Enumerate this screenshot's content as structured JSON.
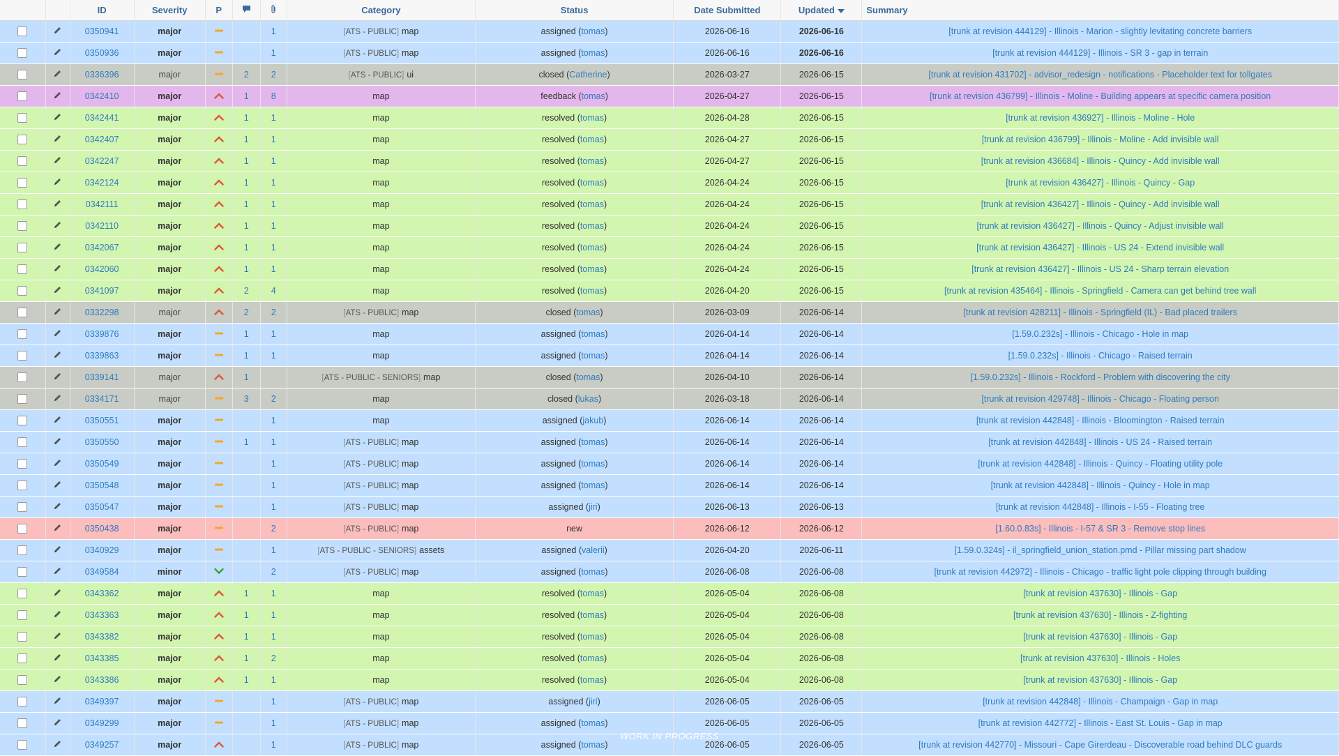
{
  "columns": {
    "id": "ID",
    "severity": "Severity",
    "priority": "P",
    "notes_icon": "speech-bubble-icon",
    "attachments_icon": "paperclip-icon",
    "category": "Category",
    "status": "Status",
    "date_submitted": "Date Submitted",
    "updated": "Updated",
    "summary": "Summary"
  },
  "colors": {
    "assigned": "#c2dfff",
    "resolved": "#d2f5b0",
    "closed": "#c9ccc4",
    "feedback": "#e3b7eb",
    "new": "#fcbdbd",
    "link": "#2f7bbf",
    "priority_high": "#e0563b",
    "priority_normal": "#f5a623",
    "priority_low": "#3aa23a"
  },
  "footer_overlay": "WORK IN PROGRESS",
  "rows": [
    {
      "id": "0350941",
      "severity": "major",
      "priority": "normal",
      "notes": "",
      "attachments": "1",
      "project": "ATS - PUBLIC",
      "category": "map",
      "status": "assigned",
      "handler": "tomas",
      "submitted": "2026-06-16",
      "updated": "2026-06-16",
      "updated_bold": true,
      "summary": "[trunk at revision 444129] - Illinois - Marion - slightly levitating concrete barriers"
    },
    {
      "id": "0350936",
      "severity": "major",
      "priority": "normal",
      "notes": "",
      "attachments": "1",
      "project": "ATS - PUBLIC",
      "category": "map",
      "status": "assigned",
      "handler": "tomas",
      "submitted": "2026-06-16",
      "updated": "2026-06-16",
      "updated_bold": true,
      "summary": "[trunk at revision 444129] - Illinois - SR 3 - gap in terrain"
    },
    {
      "id": "0336396",
      "severity": "major",
      "priority": "normal",
      "notes": "2",
      "attachments": "2",
      "project": "ATS - PUBLIC",
      "category": "ui",
      "status": "closed",
      "handler": "Catherine",
      "submitted": "2026-03-27",
      "updated": "2026-06-15",
      "updated_bold": false,
      "summary": "[trunk at revision 431702] - advisor_redesign - notifications - Placeholder text for tollgates"
    },
    {
      "id": "0342410",
      "severity": "major",
      "priority": "high",
      "notes": "1",
      "attachments": "8",
      "project": "",
      "category": "map",
      "status": "feedback",
      "handler": "tomas",
      "submitted": "2026-04-27",
      "updated": "2026-06-15",
      "updated_bold": false,
      "summary": "[trunk at revision 436799] - Illinois - Moline - Building appears at specific camera position"
    },
    {
      "id": "0342441",
      "severity": "major",
      "priority": "high",
      "notes": "1",
      "attachments": "1",
      "project": "",
      "category": "map",
      "status": "resolved",
      "handler": "tomas",
      "submitted": "2026-04-28",
      "updated": "2026-06-15",
      "updated_bold": false,
      "summary": "[trunk at revision 436927] - Illinois - Moline - Hole"
    },
    {
      "id": "0342407",
      "severity": "major",
      "priority": "high",
      "notes": "1",
      "attachments": "1",
      "project": "",
      "category": "map",
      "status": "resolved",
      "handler": "tomas",
      "submitted": "2026-04-27",
      "updated": "2026-06-15",
      "updated_bold": false,
      "summary": "[trunk at revision 436799] - Illinois - Moline - Add invisible wall"
    },
    {
      "id": "0342247",
      "severity": "major",
      "priority": "high",
      "notes": "1",
      "attachments": "1",
      "project": "",
      "category": "map",
      "status": "resolved",
      "handler": "tomas",
      "submitted": "2026-04-27",
      "updated": "2026-06-15",
      "updated_bold": false,
      "summary": "[trunk at revision 436684] - Illinois - Quincy - Add invisible wall"
    },
    {
      "id": "0342124",
      "severity": "major",
      "priority": "high",
      "notes": "1",
      "attachments": "1",
      "project": "",
      "category": "map",
      "status": "resolved",
      "handler": "tomas",
      "submitted": "2026-04-24",
      "updated": "2026-06-15",
      "updated_bold": false,
      "summary": "[trunk at revision 436427] - Illinois - Quincy - Gap"
    },
    {
      "id": "0342111",
      "severity": "major",
      "priority": "high",
      "notes": "1",
      "attachments": "1",
      "project": "",
      "category": "map",
      "status": "resolved",
      "handler": "tomas",
      "submitted": "2026-04-24",
      "updated": "2026-06-15",
      "updated_bold": false,
      "summary": "[trunk at revision 436427] - Illinois - Quincy - Add invisible wall"
    },
    {
      "id": "0342110",
      "severity": "major",
      "priority": "high",
      "notes": "1",
      "attachments": "1",
      "project": "",
      "category": "map",
      "status": "resolved",
      "handler": "tomas",
      "submitted": "2026-04-24",
      "updated": "2026-06-15",
      "updated_bold": false,
      "summary": "[trunk at revision 436427] - Illinois - Quincy - Adjust invisible wall"
    },
    {
      "id": "0342067",
      "severity": "major",
      "priority": "high",
      "notes": "1",
      "attachments": "1",
      "project": "",
      "category": "map",
      "status": "resolved",
      "handler": "tomas",
      "submitted": "2026-04-24",
      "updated": "2026-06-15",
      "updated_bold": false,
      "summary": "[trunk at revision 436427] - Illinois - US 24 - Extend invisible wall"
    },
    {
      "id": "0342060",
      "severity": "major",
      "priority": "high",
      "notes": "1",
      "attachments": "1",
      "project": "",
      "category": "map",
      "status": "resolved",
      "handler": "tomas",
      "submitted": "2026-04-24",
      "updated": "2026-06-15",
      "updated_bold": false,
      "summary": "[trunk at revision 436427] - Illinois - US 24 - Sharp terrain elevation"
    },
    {
      "id": "0341097",
      "severity": "major",
      "priority": "high",
      "notes": "2",
      "attachments": "4",
      "project": "",
      "category": "map",
      "status": "resolved",
      "handler": "tomas",
      "submitted": "2026-04-20",
      "updated": "2026-06-15",
      "updated_bold": false,
      "summary": "[trunk at revision 435464] - Illinois - Springfield - Camera can get behind tree wall"
    },
    {
      "id": "0332298",
      "severity": "major",
      "priority": "high",
      "notes": "2",
      "attachments": "2",
      "project": "ATS - PUBLIC",
      "category": "map",
      "status": "closed",
      "handler": "tomas",
      "submitted": "2026-03-09",
      "updated": "2026-06-14",
      "updated_bold": false,
      "summary": "[trunk at revision 428211] - Illinois - Springfield (IL) - Bad placed trailers"
    },
    {
      "id": "0339876",
      "severity": "major",
      "priority": "normal",
      "notes": "1",
      "attachments": "1",
      "project": "",
      "category": "map",
      "status": "assigned",
      "handler": "tomas",
      "submitted": "2026-04-14",
      "updated": "2026-06-14",
      "updated_bold": false,
      "summary": "[1.59.0.232s] - Illinois - Chicago - Hole in map"
    },
    {
      "id": "0339863",
      "severity": "major",
      "priority": "normal",
      "notes": "1",
      "attachments": "1",
      "project": "",
      "category": "map",
      "status": "assigned",
      "handler": "tomas",
      "submitted": "2026-04-14",
      "updated": "2026-06-14",
      "updated_bold": false,
      "summary": "[1.59.0.232s] - Illinois - Chicago - Raised terrain"
    },
    {
      "id": "0339141",
      "severity": "major",
      "priority": "high",
      "notes": "1",
      "attachments": "",
      "project": "ATS - PUBLIC - SENIORS",
      "category": "map",
      "status": "closed",
      "handler": "tomas",
      "submitted": "2026-04-10",
      "updated": "2026-06-14",
      "updated_bold": false,
      "summary": "[1.59.0.232s] - Illinois - Rockford - Problem with discovering the city"
    },
    {
      "id": "0334171",
      "severity": "major",
      "priority": "normal",
      "notes": "3",
      "attachments": "2",
      "project": "",
      "category": "map",
      "status": "closed",
      "handler": "lukas",
      "submitted": "2026-03-18",
      "updated": "2026-06-14",
      "updated_bold": false,
      "summary": "[trunk at revision 429748] - Illinois - Chicago - Floating person"
    },
    {
      "id": "0350551",
      "severity": "major",
      "priority": "normal",
      "notes": "",
      "attachments": "1",
      "project": "",
      "category": "map",
      "status": "assigned",
      "handler": "jakub",
      "submitted": "2026-06-14",
      "updated": "2026-06-14",
      "updated_bold": false,
      "summary": "[trunk at revision 442848] - Illinois - Bloomington - Raised terrain"
    },
    {
      "id": "0350550",
      "severity": "major",
      "priority": "normal",
      "notes": "1",
      "attachments": "1",
      "project": "ATS - PUBLIC",
      "category": "map",
      "status": "assigned",
      "handler": "tomas",
      "submitted": "2026-06-14",
      "updated": "2026-06-14",
      "updated_bold": false,
      "summary": "[trunk at revision 442848] - Illinois - US 24 - Raised terrain"
    },
    {
      "id": "0350549",
      "severity": "major",
      "priority": "normal",
      "notes": "",
      "attachments": "1",
      "project": "ATS - PUBLIC",
      "category": "map",
      "status": "assigned",
      "handler": "tomas",
      "submitted": "2026-06-14",
      "updated": "2026-06-14",
      "updated_bold": false,
      "summary": "[trunk at revision 442848] - Illinois - Quincy - Floating utility pole"
    },
    {
      "id": "0350548",
      "severity": "major",
      "priority": "normal",
      "notes": "",
      "attachments": "1",
      "project": "ATS - PUBLIC",
      "category": "map",
      "status": "assigned",
      "handler": "tomas",
      "submitted": "2026-06-14",
      "updated": "2026-06-14",
      "updated_bold": false,
      "summary": "[trunk at revision 442848] - Illinois - Quincy - Hole in map"
    },
    {
      "id": "0350547",
      "severity": "major",
      "priority": "normal",
      "notes": "",
      "attachments": "1",
      "project": "ATS - PUBLIC",
      "category": "map",
      "status": "assigned",
      "handler": "jiri",
      "submitted": "2026-06-13",
      "updated": "2026-06-13",
      "updated_bold": false,
      "summary": "[trunk at revision 442848] - Illinois - I-55 - Floating tree"
    },
    {
      "id": "0350438",
      "severity": "major",
      "priority": "normal",
      "notes": "",
      "attachments": "2",
      "project": "ATS - PUBLIC",
      "category": "map",
      "status": "new",
      "handler": "",
      "submitted": "2026-06-12",
      "updated": "2026-06-12",
      "updated_bold": false,
      "summary": "[1.60.0.83s] - Illinois - I-57 & SR 3 - Remove stop lines"
    },
    {
      "id": "0340929",
      "severity": "major",
      "priority": "normal",
      "notes": "",
      "attachments": "1",
      "project": "ATS - PUBLIC - SENIORS",
      "category": "assets",
      "status": "assigned",
      "handler": "valerii",
      "submitted": "2026-04-20",
      "updated": "2026-06-11",
      "updated_bold": false,
      "summary": "[1.59.0.324s] - il_springfield_union_station.pmd - Pillar missing part shadow"
    },
    {
      "id": "0349584",
      "severity": "minor",
      "priority": "low",
      "notes": "",
      "attachments": "2",
      "project": "ATS - PUBLIC",
      "category": "map",
      "status": "assigned",
      "handler": "tomas",
      "submitted": "2026-06-08",
      "updated": "2026-06-08",
      "updated_bold": false,
      "summary": "[trunk at revision 442972] - Illinois - Chicago - traffic light pole clipping through building"
    },
    {
      "id": "0343362",
      "severity": "major",
      "priority": "high",
      "notes": "1",
      "attachments": "1",
      "project": "",
      "category": "map",
      "status": "resolved",
      "handler": "tomas",
      "submitted": "2026-05-04",
      "updated": "2026-06-08",
      "updated_bold": false,
      "summary": "[trunk at revision 437630] - Illinois - Gap"
    },
    {
      "id": "0343363",
      "severity": "major",
      "priority": "high",
      "notes": "1",
      "attachments": "1",
      "project": "",
      "category": "map",
      "status": "resolved",
      "handler": "tomas",
      "submitted": "2026-05-04",
      "updated": "2026-06-08",
      "updated_bold": false,
      "summary": "[trunk at revision 437630] - Illinois - Z-fighting"
    },
    {
      "id": "0343382",
      "severity": "major",
      "priority": "high",
      "notes": "1",
      "attachments": "1",
      "project": "",
      "category": "map",
      "status": "resolved",
      "handler": "tomas",
      "submitted": "2026-05-04",
      "updated": "2026-06-08",
      "updated_bold": false,
      "summary": "[trunk at revision 437630] - Illinois - Gap"
    },
    {
      "id": "0343385",
      "severity": "major",
      "priority": "high",
      "notes": "1",
      "attachments": "2",
      "project": "",
      "category": "map",
      "status": "resolved",
      "handler": "tomas",
      "submitted": "2026-05-04",
      "updated": "2026-06-08",
      "updated_bold": false,
      "summary": "[trunk at revision 437630] - Illinois - Holes"
    },
    {
      "id": "0343386",
      "severity": "major",
      "priority": "high",
      "notes": "1",
      "attachments": "1",
      "project": "",
      "category": "map",
      "status": "resolved",
      "handler": "tomas",
      "submitted": "2026-05-04",
      "updated": "2026-06-08",
      "updated_bold": false,
      "summary": "[trunk at revision 437630] - Illinois - Gap"
    },
    {
      "id": "0349397",
      "severity": "major",
      "priority": "normal",
      "notes": "",
      "attachments": "1",
      "project": "ATS - PUBLIC",
      "category": "map",
      "status": "assigned",
      "handler": "jiri",
      "submitted": "2026-06-05",
      "updated": "2026-06-05",
      "updated_bold": false,
      "summary": "[trunk at revision 442848] - Illinois - Champaign - Gap in map"
    },
    {
      "id": "0349299",
      "severity": "major",
      "priority": "normal",
      "notes": "",
      "attachments": "1",
      "project": "ATS - PUBLIC",
      "category": "map",
      "status": "assigned",
      "handler": "tomas",
      "submitted": "2026-06-05",
      "updated": "2026-06-05",
      "updated_bold": false,
      "summary": "[trunk at revision 442772] - Illinois - East St. Louis - Gap in map"
    },
    {
      "id": "0349257",
      "severity": "major",
      "priority": "high",
      "notes": "",
      "attachments": "1",
      "project": "ATS - PUBLIC",
      "category": "map",
      "status": "assigned",
      "handler": "tomas",
      "submitted": "2026-06-05",
      "updated": "2026-06-05",
      "updated_bold": false,
      "summary": "[trunk at revision 442770] - Missouri - Cape Girerdeau - Discoverable road behind DLC guards"
    }
  ]
}
